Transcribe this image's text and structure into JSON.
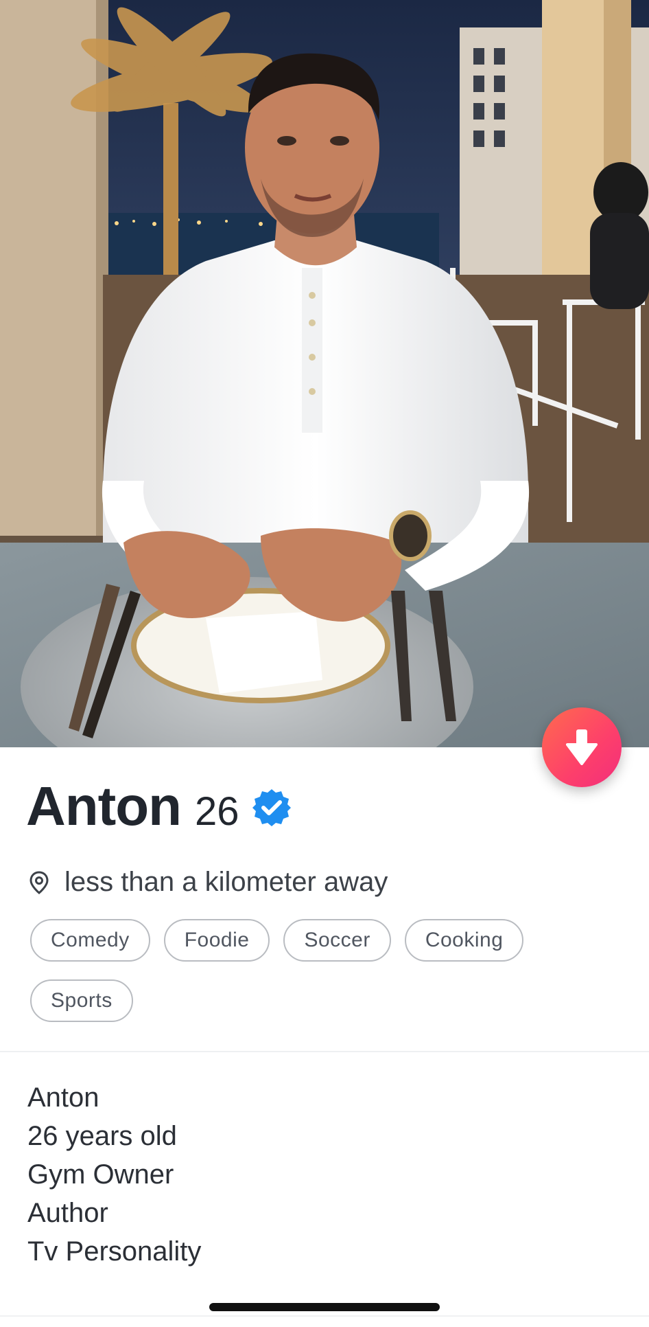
{
  "profile": {
    "name": "Anton",
    "age": "26",
    "verified_icon": "verified-badge-icon",
    "distance": "less than a kilometer away",
    "location_icon": "location-pin-icon"
  },
  "interests": [
    "Comedy",
    "Foodie",
    "Soccer",
    "Cooking",
    "Sports"
  ],
  "bio": {
    "lines": [
      "Anton",
      "26 years old",
      "Gym Owner",
      "Author",
      "Tv Personality"
    ]
  },
  "actions": {
    "collapse_icon": "arrow-down-icon"
  },
  "colors": {
    "accent_gradient_start": "#ff6b4e",
    "accent_gradient_end": "#f22e7c",
    "verified_blue": "#1f8ef0",
    "text": "#21262e"
  }
}
